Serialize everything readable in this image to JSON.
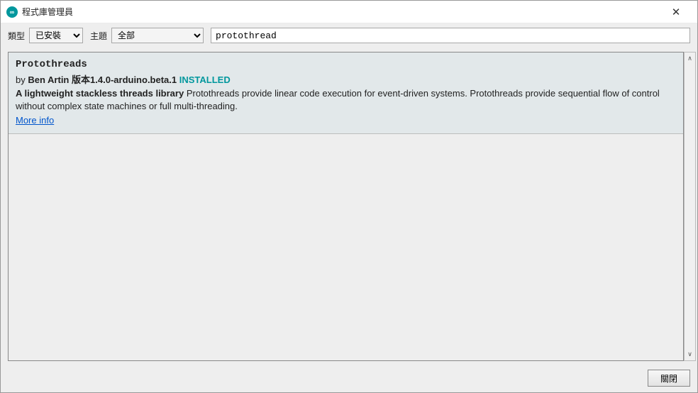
{
  "window": {
    "title": "程式庫管理員"
  },
  "filters": {
    "type_label": "類型",
    "type_value": "已安裝",
    "topic_label": "主題",
    "topic_value": "全部",
    "search_value": "protothread"
  },
  "library": {
    "name": "Protothreads",
    "by": "by",
    "author": "Ben Artin",
    "version_label": "版本",
    "version": "1.4.0-arduino.beta.1",
    "installed": "INSTALLED",
    "summary": "A lightweight stackless threads library",
    "description": "Protothreads provide linear code execution for event-driven systems. Protothreads provide sequential flow of control without complex state machines or full multi-threading.",
    "more_info": "More info"
  },
  "footer": {
    "close": "關閉"
  }
}
